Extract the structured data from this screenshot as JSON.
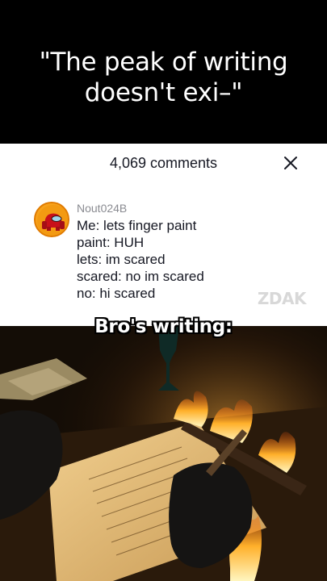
{
  "headline": "\"The peak of writing\ndoesn't exi–\"",
  "comments_panel": {
    "count_label": "4,069 comments",
    "close_icon": "close-icon",
    "comment": {
      "avatar_icon": "among-us-crewmate-avatar",
      "username": "Nout024B",
      "text": "Me: lets finger paint\npaint: HUH\nlets: im scared\nscared: no im scared\nno: hi scared"
    },
    "watermark": "ZDAK"
  },
  "video": {
    "caption": "Bro's writing:"
  }
}
